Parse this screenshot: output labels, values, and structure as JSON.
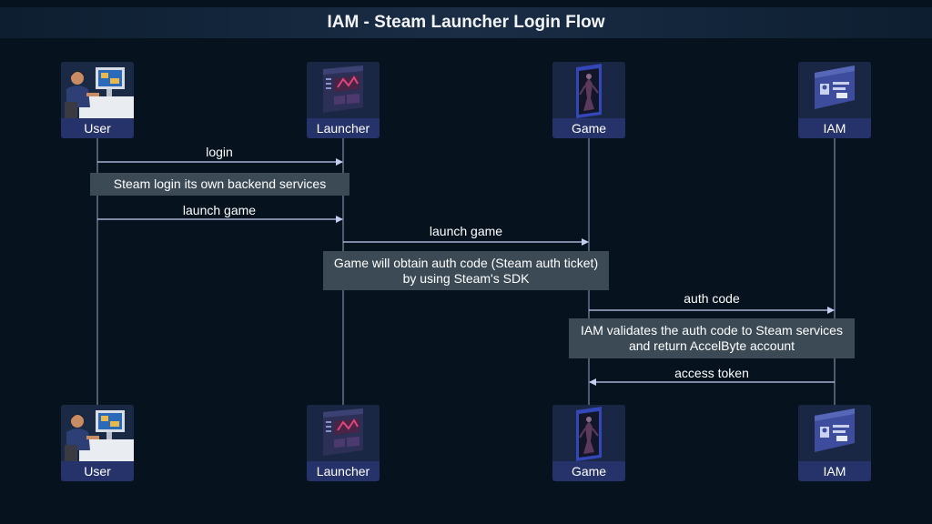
{
  "title": "IAM - Steam Launcher Login Flow",
  "participants": [
    {
      "id": "user",
      "label": "User",
      "icon": "user-at-computer-icon"
    },
    {
      "id": "launcher",
      "label": "Launcher",
      "icon": "launcher-window-icon"
    },
    {
      "id": "game",
      "label": "Game",
      "icon": "game-phone-icon"
    },
    {
      "id": "iam",
      "label": "IAM",
      "icon": "id-card-icon"
    }
  ],
  "messages": [
    {
      "from": "user",
      "to": "launcher",
      "label": "login"
    },
    {
      "from": "user",
      "to": "launcher",
      "label": "launch game"
    },
    {
      "from": "launcher",
      "to": "game",
      "label": "launch game"
    },
    {
      "from": "game",
      "to": "iam",
      "label": "auth code"
    },
    {
      "from": "iam",
      "to": "game",
      "label": "access token"
    }
  ],
  "notes": [
    {
      "lines": [
        "Steam login its own backend services"
      ]
    },
    {
      "lines": [
        "Game will obtain auth code (Steam auth ticket)",
        "by using Steam's SDK"
      ]
    },
    {
      "lines": [
        "IAM validates the auth code to Steam services",
        "and return AccelByte account"
      ]
    }
  ],
  "colors": {
    "background": "#06131f",
    "lifeline": "#9aa3c4",
    "arrow": "#c7cdf0",
    "note_bg": "#3c4a55",
    "label_bg": "#26336a"
  }
}
